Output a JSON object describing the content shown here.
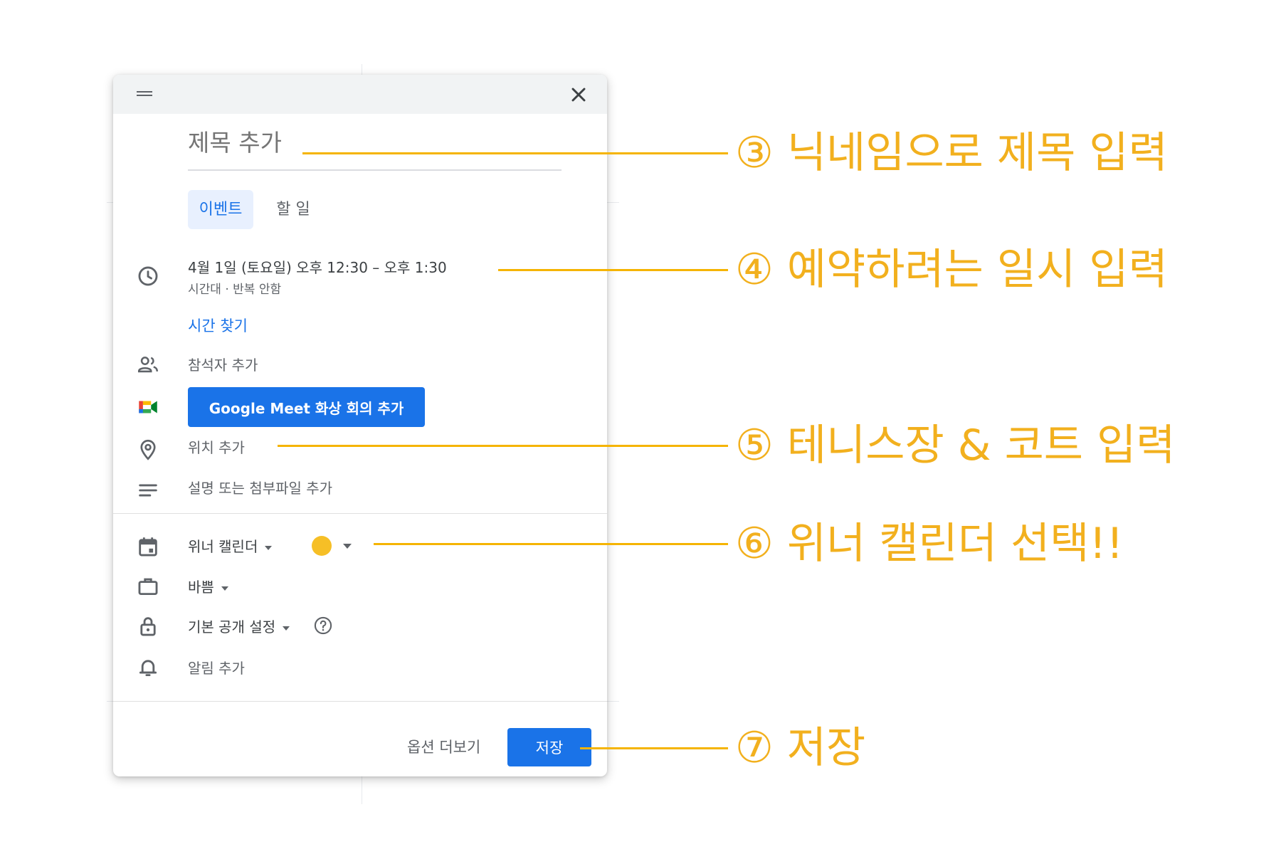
{
  "dialog": {
    "title_placeholder": "제목 추가",
    "tabs": [
      {
        "label": "이벤트",
        "selected": true
      },
      {
        "label": "할 일",
        "selected": false
      }
    ],
    "datetime": {
      "text": "4월 1일 (토요일)   오후 12:30  –  오후 1:30",
      "sub": "시간대 · 반복 안함"
    },
    "find_time": "시간 찾기",
    "guests": "참석자 추가",
    "meet_button": "Google Meet 화상 회의 추가",
    "location": "위치 추가",
    "description": "설명 또는 첨부파일 추가",
    "calendar": "위너 캘린더",
    "event_color": "#f6bf26",
    "availability": "바쁨",
    "visibility": "기본 공개 설정",
    "notification": "알림 추가",
    "more_options": "옵션 더보기",
    "save": "저장"
  },
  "annotations": [
    {
      "text": "③ 닉네임으로 제목 입력"
    },
    {
      "text": "④ 예약하려는 일시 입력"
    },
    {
      "text": "⑤ 테니스장 & 코트 입력"
    },
    {
      "text": "⑥ 위너 캘린더 선택!!"
    },
    {
      "text": "⑦ 저장"
    }
  ],
  "colors": {
    "accent": "#1a73e8",
    "annotation": "#f2b01e"
  }
}
